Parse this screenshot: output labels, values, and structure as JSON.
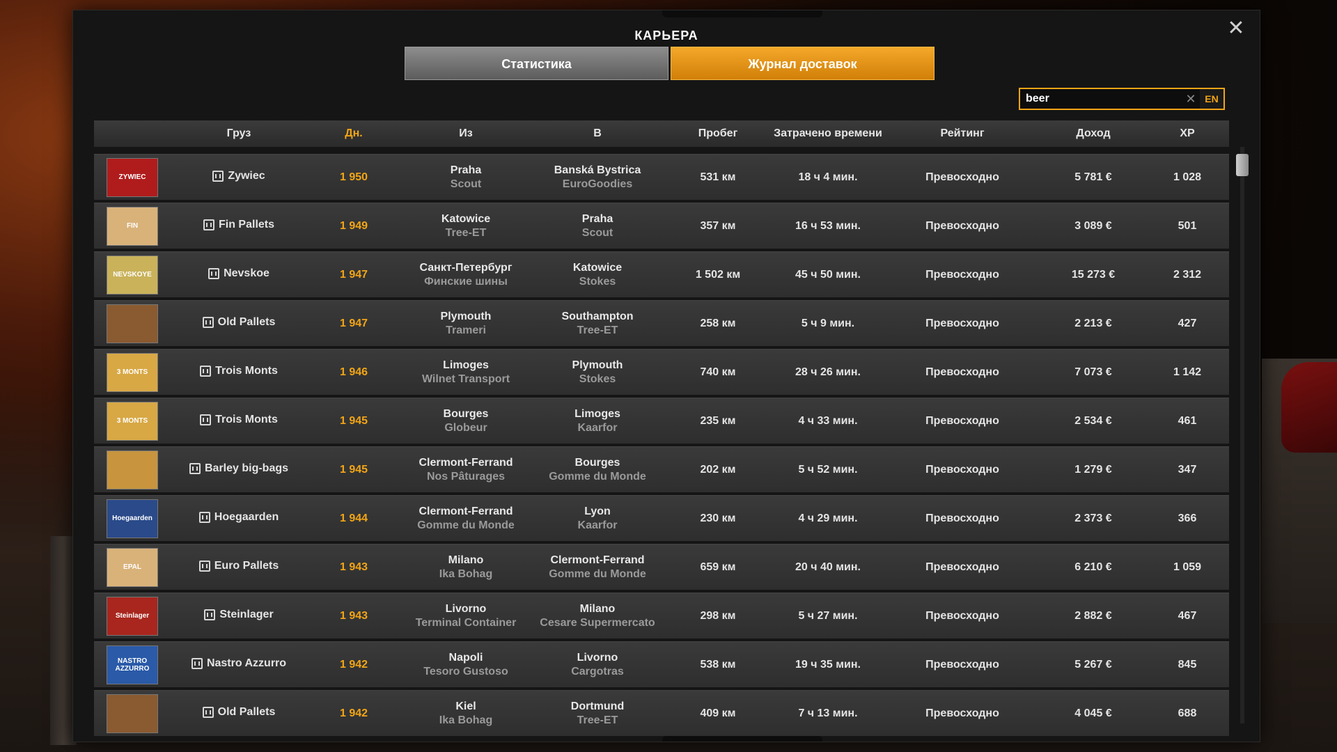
{
  "title": "КАРЬЕРА",
  "close_symbol": "✕",
  "tabs": [
    {
      "label": "Статистика",
      "active": false
    },
    {
      "label": "Журнал доставок",
      "active": true
    }
  ],
  "search": {
    "value": "beer",
    "clear_symbol": "✕",
    "lang": "EN"
  },
  "columns": {
    "cargo": "Груз",
    "day": "Дн.",
    "from": "Из",
    "to": "В",
    "distance": "Пробег",
    "time": "Затрачено времени",
    "rating": "Рейтинг",
    "income": "Доход",
    "xp": "XP"
  },
  "colors": {
    "accent": "#f2a516",
    "row_bg": "#333333"
  },
  "rows": [
    {
      "cargo": "Zywiec",
      "day": "1 950",
      "from_city": "Praha",
      "from_company": "Scout",
      "to_city": "Banská Bystrica",
      "to_company": "EuroGoodies",
      "distance": "531 км",
      "time": "18 ч 4 мин.",
      "rating": "Превосходно",
      "income": "5 781 €",
      "xp": "1 028",
      "thumb_label": "ZYWIEC",
      "thumb_color": "#b01c1c"
    },
    {
      "cargo": "Fin Pallets",
      "day": "1 949",
      "from_city": "Katowice",
      "from_company": "Tree-ET",
      "to_city": "Praha",
      "to_company": "Scout",
      "distance": "357 км",
      "time": "16 ч 53 мин.",
      "rating": "Превосходно",
      "income": "3 089 €",
      "xp": "501",
      "thumb_label": "FIN",
      "thumb_color": "#d9b27a"
    },
    {
      "cargo": "Nevskoe",
      "day": "1 947",
      "from_city": "Санкт-Петербург",
      "from_company": "Финские шины",
      "to_city": "Katowice",
      "to_company": "Stokes",
      "distance": "1 502 км",
      "time": "45 ч 50 мин.",
      "rating": "Превосходно",
      "income": "15 273 €",
      "xp": "2 312",
      "thumb_label": "NEVSKOYE",
      "thumb_color": "#c9b25a"
    },
    {
      "cargo": "Old Pallets",
      "day": "1 947",
      "from_city": "Plymouth",
      "from_company": "Trameri",
      "to_city": "Southampton",
      "to_company": "Tree-ET",
      "distance": "258 км",
      "time": "5 ч 9 мин.",
      "rating": "Превосходно",
      "income": "2 213 €",
      "xp": "427",
      "thumb_label": "",
      "thumb_color": "#8a5a30"
    },
    {
      "cargo": "Trois Monts",
      "day": "1 946",
      "from_city": "Limoges",
      "from_company": "Wilnet Transport",
      "to_city": "Plymouth",
      "to_company": "Stokes",
      "distance": "740 км",
      "time": "28 ч 26 мин.",
      "rating": "Превосходно",
      "income": "7 073 €",
      "xp": "1 142",
      "thumb_label": "3 MONTS",
      "thumb_color": "#d8a845"
    },
    {
      "cargo": "Trois Monts",
      "day": "1 945",
      "from_city": "Bourges",
      "from_company": "Globeur",
      "to_city": "Limoges",
      "to_company": "Kaarfor",
      "distance": "235 км",
      "time": "4 ч 33 мин.",
      "rating": "Превосходно",
      "income": "2 534 €",
      "xp": "461",
      "thumb_label": "3 MONTS",
      "thumb_color": "#d8a845"
    },
    {
      "cargo": "Barley big-bags",
      "day": "1 945",
      "from_city": "Clermont-Ferrand",
      "from_company": "Nos Pâturages",
      "to_city": "Bourges",
      "to_company": "Gomme du Monde",
      "distance": "202 км",
      "time": "5 ч 52 мин.",
      "rating": "Превосходно",
      "income": "1 279 €",
      "xp": "347",
      "thumb_label": "",
      "thumb_color": "#c8953e"
    },
    {
      "cargo": "Hoegaarden",
      "day": "1 944",
      "from_city": "Clermont-Ferrand",
      "from_company": "Gomme du Monde",
      "to_city": "Lyon",
      "to_company": "Kaarfor",
      "distance": "230 км",
      "time": "4 ч 29 мин.",
      "rating": "Превосходно",
      "income": "2 373 €",
      "xp": "366",
      "thumb_label": "Hoegaarden",
      "thumb_color": "#2a4a8a"
    },
    {
      "cargo": "Euro Pallets",
      "day": "1 943",
      "from_city": "Milano",
      "from_company": "Ika Bohag",
      "to_city": "Clermont-Ferrand",
      "to_company": "Gomme du Monde",
      "distance": "659 км",
      "time": "20 ч 40 мин.",
      "rating": "Превосходно",
      "income": "6 210 €",
      "xp": "1 059",
      "thumb_label": "EPAL",
      "thumb_color": "#d9b27a"
    },
    {
      "cargo": "Steinlager",
      "day": "1 943",
      "from_city": "Livorno",
      "from_company": "Terminal Container",
      "to_city": "Milano",
      "to_company": "Cesare Supermercato",
      "distance": "298 км",
      "time": "5 ч 27 мин.",
      "rating": "Превосходно",
      "income": "2 882 €",
      "xp": "467",
      "thumb_label": "Steinlager",
      "thumb_color": "#a8261e"
    },
    {
      "cargo": "Nastro Azzurro",
      "day": "1 942",
      "from_city": "Napoli",
      "from_company": "Tesoro Gustoso",
      "to_city": "Livorno",
      "to_company": "Cargotras",
      "distance": "538 км",
      "time": "19 ч 35 мин.",
      "rating": "Превосходно",
      "income": "5 267 €",
      "xp": "845",
      "thumb_label": "NASTRO AZZURRO",
      "thumb_color": "#2a5aa8"
    },
    {
      "cargo": "Old Pallets",
      "day": "1 942",
      "from_city": "Kiel",
      "from_company": "Ika Bohag",
      "to_city": "Dortmund",
      "to_company": "Tree-ET",
      "distance": "409 км",
      "time": "7 ч 13 мин.",
      "rating": "Превосходно",
      "income": "4 045 €",
      "xp": "688",
      "thumb_label": "",
      "thumb_color": "#8a5a30"
    }
  ]
}
